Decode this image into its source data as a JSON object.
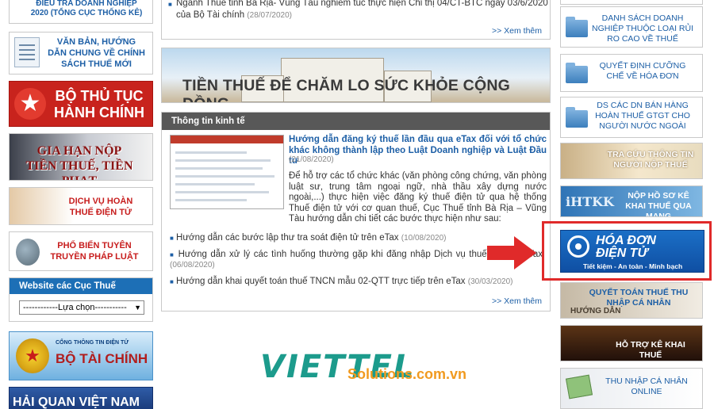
{
  "left": {
    "dieutra": "ĐIỀU TRA DOANH NGHIỆP 2020 (Tổng cục Thống kê)",
    "vanban": "VĂN BẢN, HƯỚNG DẪN CHUNG VỀ CHÍNH SÁCH THUẾ MỚI",
    "tthc_line1": "BỘ THỦ TỤC",
    "tthc_line2": "HÀNH CHÍNH",
    "giahan_line1": "GIA HẠN NỘP",
    "giahan_line2": "TIỀN THUẾ, TIỀN PHẠT",
    "dichvu": "DỊCH VỤ HOÀN THUẾ ĐIỆN TỬ",
    "phobien": "PHỔ BIẾN TUYÊN TRUYỀN PHÁP LUẬT",
    "cucthue_title": "Website các Cục Thuế",
    "cucthue_select": "------------Lựa chọn-----------",
    "btc_small": "CỔNG THÔNG TIN ĐIỆN TỬ",
    "btc_big": "BỘ TÀI CHÍNH",
    "haiquan": "HẢI QUAN VIỆT NAM"
  },
  "center": {
    "top_item": "Ngành Thuế tỉnh Bà Rịa- Vũng Tàu nghiêm túc thực hiện Chỉ thị 04/CT-BTC ngày 03/6/2020 của Bộ Tài chính",
    "top_item_date": "(28/07/2020)",
    "xemthem": ">> Xem thêm",
    "banner_text": "TIỀN THUẾ ĐỂ CHĂM LO SỨC KHỎE CỘNG ĐỒNG",
    "econ_header": "Thông tin kinh tế",
    "feat_title": "Hướng dẫn đăng ký thuế lần đầu qua eTax đối với tổ chức khác không thành lập theo Luật Doanh nghiệp và Luật Đầu tư",
    "feat_date": "(21/08/2020)",
    "feat_summary": "Để hỗ trợ các tổ chức khác (văn phòng công chứng, văn phòng luật sư, trung tâm ngoại ngữ, nhà thầu xây dựng nước ngoài,...) thực hiện việc đăng ký thuế điện tử qua hệ thống Thuế điện tử với cơ quan thuế, Cục Thuế tỉnh Bà Rịa – Vũng Tàu hướng dẫn chi tiết các bước thực hiện như sau:",
    "thumb_title": "THUẾ ĐIỆN TỬ",
    "items": [
      {
        "text": "Hướng dẫn các bước lập thư tra soát điện tử trên eTax",
        "date": "(10/08/2020)"
      },
      {
        "text": "Hướng dẫn xử lý các tình huống thường gặp khi đăng nhập Dịch vụ thuế điện tử eTax",
        "date": "(06/08/2020)"
      },
      {
        "text": "Hướng dẫn khai quyết toán thuế TNCN mẫu 02-QTT trực tiếp trên eTax",
        "date": "(30/03/2020)"
      }
    ],
    "xemthem2": ">> Xem thêm"
  },
  "logo": {
    "viettel": "VIETTEL",
    "solutions": "Solutions.com.vn"
  },
  "right": {
    "r2": "DANH SÁCH DOANH NGHIỆP THUỘC LOẠI RỦI RO CAO VỀ THUẾ",
    "r3": "QUYẾT ĐỊNH CƯỠNG CHẾ VỀ HÓA ĐƠN",
    "r4": "DS CÁC DN BÁN HÀNG HOÀN THUẾ GTGT CHO NGƯỜI NƯỚC NGOÀI",
    "r5": "TRA CỨU THÔNG TIN NGƯỜI NỘP THUẾ",
    "r6_logo": "iHTKK",
    "r6": "NỘP HỒ SƠ KÊ KHAI THUẾ QUA MẠNG",
    "hoadon_line1": "HÓA ĐƠN",
    "hoadon_line2": "ĐIỆN TỬ",
    "hoadon_slogan": "Tiết kiệm - An toàn - Minh bạch",
    "r8": "QUYẾT TOÁN THUẾ THU NHẬP CÁ NHÂN",
    "r8_guide": "HƯỚNG DẪN",
    "r9": "HỖ TRỢ KÊ KHAI THUẾ",
    "r10": "THU NHẬP CÁ NHÂN ONLINE"
  },
  "colors": {
    "accent_blue": "#1d5fa6",
    "highlight_red": "#e02a2a",
    "header_gray": "#585858"
  }
}
